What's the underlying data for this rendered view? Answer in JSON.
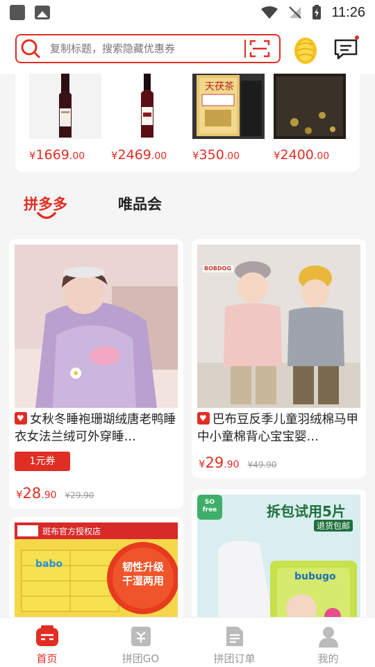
{
  "status_bar": {
    "time": "11:26"
  },
  "search": {
    "placeholder": "复制标题，搜索隐藏优惠券"
  },
  "top_products": [
    {
      "yuan": "¥",
      "int": "1669",
      "dec": ".00",
      "kind": "wine"
    },
    {
      "yuan": "¥",
      "int": "2469",
      "dec": ".00",
      "kind": "wine"
    },
    {
      "yuan": "¥",
      "int": "350",
      "dec": ".00",
      "kind": "tea-box",
      "label": "天茯茶"
    },
    {
      "yuan": "¥",
      "int": "2400",
      "dec": ".00",
      "kind": "tea-brick"
    }
  ],
  "tabs": [
    {
      "label": "拼多多",
      "active": true
    },
    {
      "label": "唯品会",
      "active": false
    }
  ],
  "products": [
    {
      "title": "女秋冬睡袍珊瑚绒唐老鸭睡衣女法兰绒可外穿睡…",
      "coupon": "1元券",
      "yuan": "¥",
      "int": "28",
      "dec": ".90",
      "old_price": "¥29.90"
    },
    {
      "title": "巴布豆反季儿童羽绒棉马甲中小童棉背心宝宝婴…",
      "yuan": "¥",
      "int": "29",
      "dec": ".90",
      "old_price": "¥49.90",
      "brand": "BOBDOG"
    },
    {
      "banner": "斑布官方授权店",
      "brand": "babo",
      "promo": "韧性升级 干湿两用"
    },
    {
      "badge": "SO free",
      "promo": "拆包试用5片",
      "sub": "退货包邮",
      "brand": "bubugo"
    }
  ],
  "bottom_nav": [
    {
      "label": "首页",
      "active": true,
      "icon": "home-icon"
    },
    {
      "label": "拼团GO",
      "active": false,
      "icon": "group-go-icon"
    },
    {
      "label": "拼团订单",
      "active": false,
      "icon": "order-icon"
    },
    {
      "label": "我的",
      "active": false,
      "icon": "profile-icon"
    }
  ],
  "colors": {
    "brand_red": "#e02e24",
    "text": "#222222",
    "muted": "#999999"
  }
}
